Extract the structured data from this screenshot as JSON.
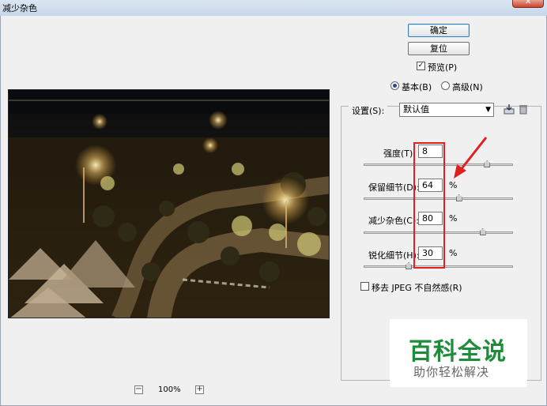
{
  "window": {
    "title": "减少杂色",
    "close_symbol": "✕"
  },
  "buttons": {
    "ok": "确定",
    "reset": "复位"
  },
  "preview_toggle": {
    "label": "预览(P)",
    "checked": true
  },
  "modes": [
    {
      "label": "基本(B)",
      "selected": true
    },
    {
      "label": "高级(N)",
      "selected": false
    }
  ],
  "settings": {
    "label": "设置(S):",
    "value": "默认值"
  },
  "sliders": [
    {
      "label": "强度(T):",
      "value": "8",
      "unit": "",
      "fraction": 0.83
    },
    {
      "label": "保留细节(D):",
      "value": "64",
      "unit": "%",
      "fraction": 0.64
    },
    {
      "label": "减少杂色(C):",
      "value": "80",
      "unit": "%",
      "fraction": 0.8
    },
    {
      "label": "锐化细节(H):",
      "value": "30",
      "unit": "%",
      "fraction": 0.3
    }
  ],
  "jpeg_option": {
    "label": "移去 JPEG 不自然感(R)",
    "checked": false
  },
  "zoom": {
    "level": "100%",
    "minus": "−",
    "plus": "+"
  },
  "watermark": {
    "title": "百科全说",
    "subtitle": "助你轻松解决"
  },
  "colors": {
    "highlight": "#e02020",
    "watermark": "#1f8c3b"
  }
}
